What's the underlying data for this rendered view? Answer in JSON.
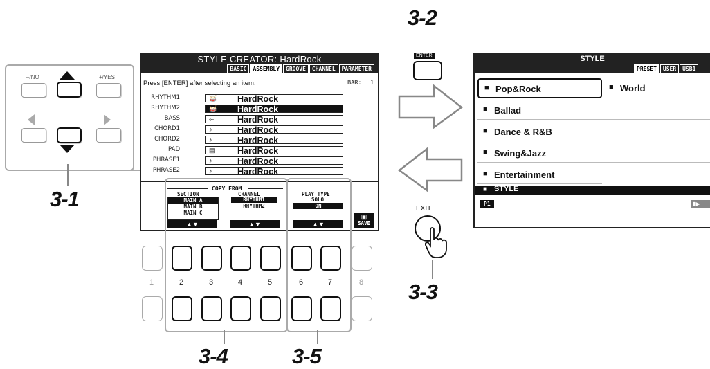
{
  "callouts": {
    "c31": "3-1",
    "c32": "3-2",
    "c33": "3-3",
    "c34": "3-4",
    "c35": "3-5"
  },
  "nav_panel": {
    "no_label": "–/NO",
    "yes_label": "+/YES"
  },
  "enter_key": {
    "label": "ENTER"
  },
  "exit_key": {
    "label": "EXIT"
  },
  "style_creator": {
    "title": "STYLE CREATOR: HardRock",
    "tabs": [
      "BASIC",
      "ASSEMBLY",
      "GROOVE",
      "CHANNEL",
      "PARAMETER"
    ],
    "active_tab": "ASSEMBLY",
    "instruction": "Press [ENTER] after selecting an item.",
    "bar_label": "BAR:",
    "bar_value": "1",
    "rows": [
      {
        "label": "RHYTHM1",
        "value": "HardRock",
        "icon": "drum-kit-icon"
      },
      {
        "label": "RHYTHM2",
        "value": "HardRock",
        "icon": "drum-kit-icon"
      },
      {
        "label": "BASS",
        "value": "HardRock",
        "icon": "bass-guitar-icon"
      },
      {
        "label": "CHORD1",
        "value": "HardRock",
        "icon": "guitar-icon"
      },
      {
        "label": "CHORD2",
        "value": "HardRock",
        "icon": "guitar-icon"
      },
      {
        "label": "PAD",
        "value": "HardRock",
        "icon": "organ-icon"
      },
      {
        "label": "PHRASE1",
        "value": "HardRock",
        "icon": "guitar-icon"
      },
      {
        "label": "PHRASE2",
        "value": "HardRock",
        "icon": "guitar-icon"
      }
    ],
    "selected_row": "RHYTHM2",
    "copy_from": {
      "heading": "COPY FROM",
      "section_heading": "SECTION",
      "sections": [
        "MAIN A",
        "MAIN B",
        "MAIN C"
      ],
      "selected_section": "MAIN A",
      "channel_heading": "CHANNEL",
      "channels": [
        "RHYTHM1",
        "RHYTHM2"
      ],
      "selected_channel": "RHYTHM1"
    },
    "play_type": {
      "heading": "PLAY TYPE",
      "mode": "SOLO",
      "state": "ON"
    },
    "updown": "▲▼",
    "save_label": "SAVE"
  },
  "panel_buttons": {
    "numbers": [
      "1",
      "2",
      "3",
      "4",
      "5",
      "6",
      "7",
      "8"
    ]
  },
  "style_screen": {
    "title": "STYLE",
    "tabs": [
      "PRESET",
      "USER",
      "USB1"
    ],
    "active_tab": "PRESET",
    "left_items": [
      "Pop&Rock",
      "Ballad",
      "Dance & R&B",
      "Swing&Jazz",
      "Entertainment"
    ],
    "right_items": [
      "World"
    ],
    "selected_item": "Pop&Rock",
    "path_label": "STYLE",
    "page_label": "P1"
  }
}
